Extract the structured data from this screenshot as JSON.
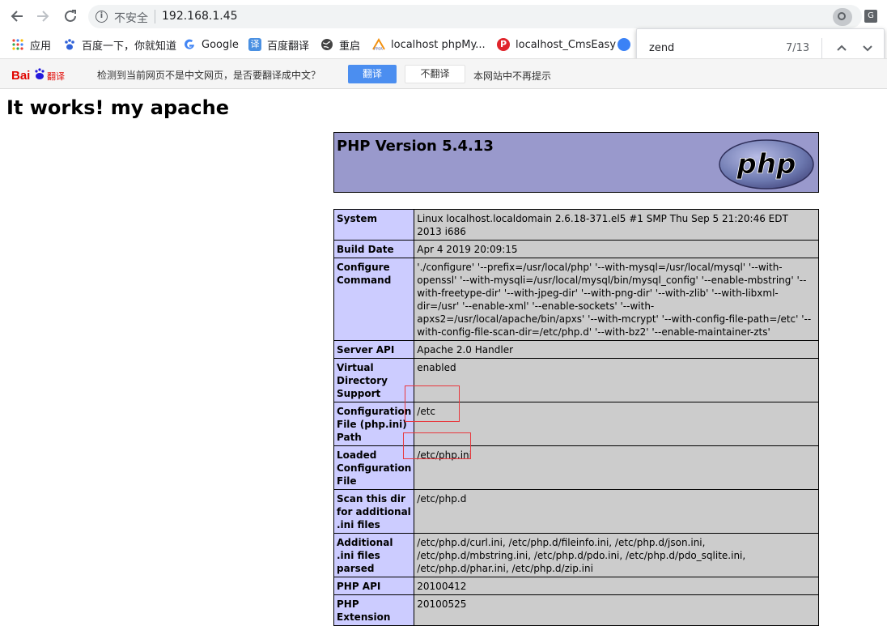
{
  "browser": {
    "back_icon": "arrow-left",
    "forward_icon": "arrow-right",
    "reload_icon": "reload",
    "security_label": "不安全",
    "url": "192.168.1.45"
  },
  "bookmarks": [
    {
      "label": "应用",
      "icon": "apps-grid",
      "color": "#e8453c"
    },
    {
      "label": "百度一下，你就知道",
      "icon": "baidu-paw",
      "color": "#3062d8"
    },
    {
      "label": "Google",
      "icon": "google-g",
      "color": "#4285f4"
    },
    {
      "label": "百度翻译",
      "icon": "translate",
      "color": "#4a90e2"
    },
    {
      "label": "重启",
      "icon": "globe",
      "color": "#444444"
    },
    {
      "label": "localhost phpMy...",
      "icon": "phpmyadmin",
      "color": "#f29111"
    },
    {
      "label": "localhost_CmsEasy",
      "icon": "p-logo",
      "color": "#e0242b"
    }
  ],
  "find": {
    "query": "zend",
    "count": "7/13",
    "prev": "^",
    "next": "v"
  },
  "translate_bar": {
    "logo": "Bai翻译",
    "message": "检测到当前网页不是中文网页，是否要翻译成中文？",
    "translate_button": "翻译",
    "no_translate_button": "不翻译",
    "never_link": "本网站中不再提示"
  },
  "page": {
    "heading": "It works! my apache",
    "php_version": "PHP Version 5.4.13",
    "php_logo_text": "php",
    "rows": [
      {
        "key": "System",
        "value": "Linux localhost.localdomain 2.6.18-371.el5 #1 SMP Thu Sep 5 21:20:46 EDT 2013 i686"
      },
      {
        "key": "Build Date",
        "value": "Apr 4 2019 20:09:15"
      },
      {
        "key": "Configure Command",
        "value": "'./configure' '--prefix=/usr/local/php' '--with-mysql=/usr/local/mysql' '--with-openssl' '--with-mysqli=/usr/local/mysql/bin/mysql_config' '--enable-mbstring' '--with-freetype-dir' '--with-jpeg-dir' '--with-png-dir' '--with-zlib' '--with-libxml-dir=/usr' '--enable-xml' '--enable-sockets' '--with-apxs2=/usr/local/apache/bin/apxs' '--with-mcrypt' '--with-config-file-path=/etc' '--with-config-file-scan-dir=/etc/php.d' '--with-bz2' '--enable-maintainer-zts'"
      },
      {
        "key": "Server API",
        "value": "Apache 2.0 Handler"
      },
      {
        "key": "Virtual Directory Support",
        "value": "enabled"
      },
      {
        "key": "Configuration File (php.ini) Path",
        "value": "/etc"
      },
      {
        "key": "Loaded Configuration File",
        "value": "/etc/php.ini"
      },
      {
        "key": "Scan this dir for additional .ini files",
        "value": "/etc/php.d"
      },
      {
        "key": "Additional .ini files parsed",
        "value": "/etc/php.d/curl.ini, /etc/php.d/fileinfo.ini, /etc/php.d/json.ini, /etc/php.d/mbstring.ini, /etc/php.d/pdo.ini, /etc/php.d/pdo_sqlite.ini, /etc/php.d/phar.ini, /etc/php.d/zip.ini"
      },
      {
        "key": "PHP API",
        "value": "20100412"
      },
      {
        "key": "PHP Extension",
        "value": "20100525"
      }
    ]
  },
  "colors": {
    "php_header_bg": "#9999cc",
    "key_cell_bg": "#ccccff",
    "value_cell_bg": "#cccccc",
    "highlight_box": "#e8383d",
    "translate_button_bg": "#4b8ef0"
  }
}
